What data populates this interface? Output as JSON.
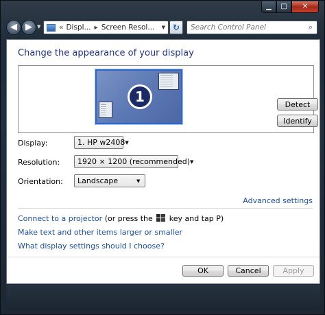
{
  "titlebar": {
    "minimize_icon": "minimize-icon",
    "maximize_icon": "maximize-icon",
    "close_icon": "close-icon",
    "minimize_glyph": "▁",
    "maximize_glyph": "□",
    "close_glyph": "✕"
  },
  "navigation": {
    "back_glyph": "◀",
    "forward_glyph": "▶",
    "dropdown_glyph": "▼",
    "address_prefix": "«",
    "breadcrumbs": [
      "Displ...",
      "Screen Resol..."
    ],
    "breadcrumb_separator": "▸",
    "refresh_glyph": "↻",
    "search_placeholder": "Search Control Panel",
    "search_glyph": "⌕"
  },
  "page": {
    "title": "Change the appearance of your display",
    "monitor_number": "1",
    "detect_label": "Detect",
    "identify_label": "Identify"
  },
  "settings": {
    "display_label": "Display:",
    "display_value": "1. HP w2408",
    "resolution_label": "Resolution:",
    "resolution_value": "1920 × 1200 (recommended)",
    "orientation_label": "Orientation:",
    "orientation_value": "Landscape",
    "dropdown_glyph": "▼"
  },
  "links": {
    "advanced": "Advanced settings",
    "projector_link": "Connect to a projector",
    "projector_text_before": "(or press the",
    "projector_text_after": "key and tap P)",
    "text_size": "Make text and other items larger or smaller",
    "help": "What display settings should I choose?"
  },
  "footer": {
    "ok_label": "OK",
    "cancel_label": "Cancel",
    "apply_label": "Apply"
  },
  "colors": {
    "link": "#1d4fa0",
    "title": "#1e3287",
    "monitor_fill": "#5d79b4",
    "selection_border": "#2d66c8"
  }
}
